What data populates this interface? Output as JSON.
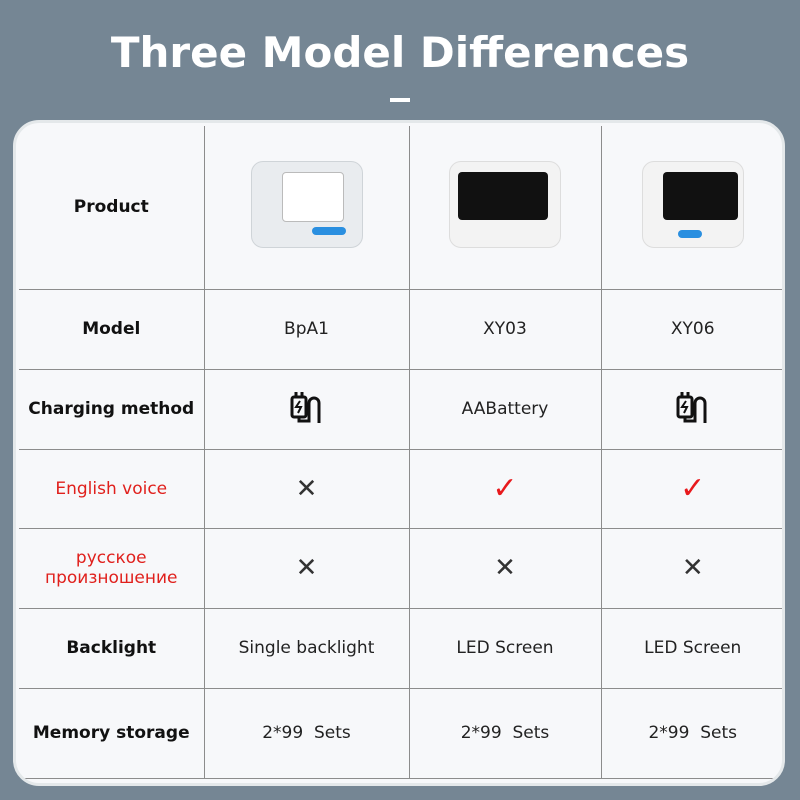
{
  "title": "Three Model Differences",
  "rows": [
    {
      "label": "Product",
      "cells": [
        "",
        "",
        ""
      ],
      "type": "image"
    },
    {
      "label": "Model",
      "cells": [
        "BpA1",
        "XY03",
        "XY06"
      ]
    },
    {
      "label": "Charging method",
      "cells": [
        "charger-icon",
        "AABattery",
        "charger-icon"
      ]
    },
    {
      "label": "English voice",
      "cells": [
        "cross-icon",
        "check-icon",
        "check-icon"
      ]
    },
    {
      "label": "русское произношение",
      "cells": [
        "cross-icon",
        "cross-icon",
        "cross-icon"
      ]
    },
    {
      "label": "Backlight",
      "cells": [
        "Single backlight",
        "LED Screen",
        "LED Screen"
      ]
    },
    {
      "label": "Memory storage",
      "cells": [
        "2*99  Sets",
        "2*99  Sets",
        "2*99  Sets"
      ]
    }
  ],
  "colors": {
    "background": "#758694",
    "highlight": "#e0201c"
  }
}
